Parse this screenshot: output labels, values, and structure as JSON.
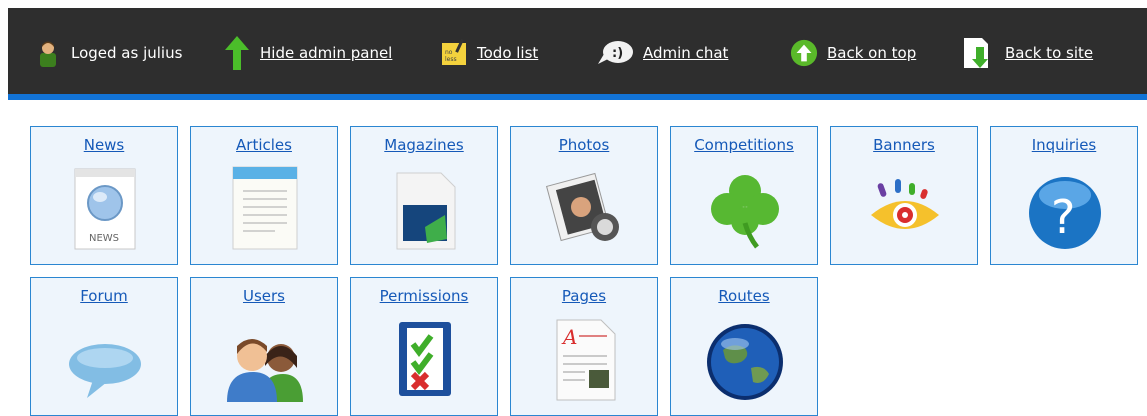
{
  "topbar": {
    "user_label": "Loged as julius",
    "hide_panel": "Hide admin panel",
    "todo": "Todo list",
    "chat": "Admin chat",
    "top": "Back on top",
    "site": "Back to site"
  },
  "modules": [
    {
      "label": "News",
      "icon": "news-icon"
    },
    {
      "label": "Articles",
      "icon": "articles-icon"
    },
    {
      "label": "Magazines",
      "icon": "magazines-icon"
    },
    {
      "label": "Photos",
      "icon": "photos-icon"
    },
    {
      "label": "Competitions",
      "icon": "clover-icon"
    },
    {
      "label": "Banners",
      "icon": "banners-eye-icon"
    },
    {
      "label": "Inquiries",
      "icon": "question-icon"
    },
    {
      "label": "Forum",
      "icon": "speech-bubble-icon"
    },
    {
      "label": "Users",
      "icon": "users-icon"
    },
    {
      "label": "Permissions",
      "icon": "checklist-icon"
    },
    {
      "label": "Pages",
      "icon": "document-icon"
    },
    {
      "label": "Routes",
      "icon": "globe-icon"
    }
  ],
  "colors": {
    "topbar_bg": "#2e2e2e",
    "accent_stripe": "#1273d6",
    "tile_border": "#2b86d1",
    "tile_bg": "#eef5fc",
    "link": "#1559b8"
  }
}
